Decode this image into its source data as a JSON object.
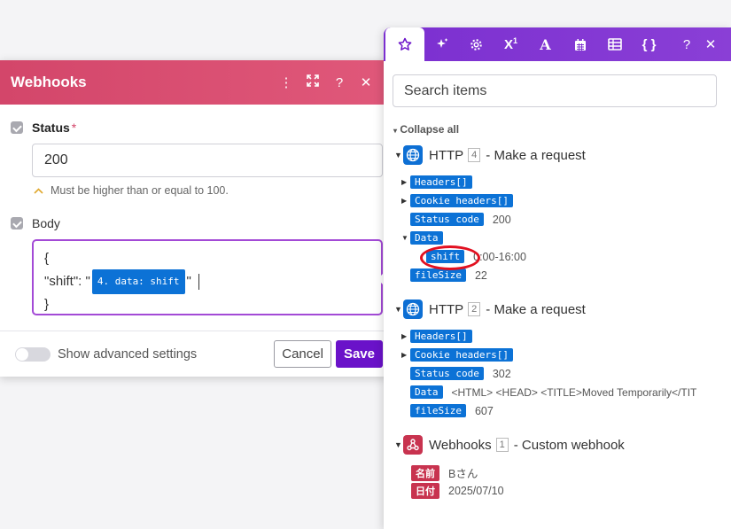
{
  "dialog": {
    "title": "Webhooks",
    "status_label": "Status",
    "required_mark": "*",
    "status_value": "200",
    "status_hint": "Must be higher than or equal to 100.",
    "body_label": "Body",
    "body_line1": "{",
    "body_key": "\"shift\": \"",
    "body_pill": "4. data: shift",
    "body_after": "\"",
    "body_line3": "}",
    "advanced_label": "Show advanced settings",
    "cancel": "Cancel",
    "save": "Save"
  },
  "panel": {
    "tabs": [
      "star-icon",
      "sparkle-icon",
      "gear-icon",
      "superscript-icon",
      "text-icon",
      "calendar-icon",
      "table-icon",
      "braces-icon"
    ],
    "help": "?",
    "close": "✕",
    "search_placeholder": "Search items",
    "collapse_all": "Collapse all",
    "modules": [
      {
        "name": "HTTP",
        "num": "4",
        "desc": "- Make a request",
        "items": [
          {
            "tag": "Headers[]",
            "value": ""
          },
          {
            "tag": "Cookie headers[]",
            "value": ""
          },
          {
            "tag": "Status code",
            "value": "200"
          },
          {
            "tag": "Data",
            "value": ""
          },
          {
            "tag": "shift",
            "value": "0:00-16:00"
          },
          {
            "tag": "fileSize",
            "value": "22"
          }
        ]
      },
      {
        "name": "HTTP",
        "num": "2",
        "desc": "- Make a request",
        "items": [
          {
            "tag": "Headers[]",
            "value": ""
          },
          {
            "tag": "Cookie headers[]",
            "value": ""
          },
          {
            "tag": "Status code",
            "value": "302"
          },
          {
            "tag": "Data",
            "value": "<HTML> <HEAD> <TITLE>Moved Temporarily</TIT"
          },
          {
            "tag": "fileSize",
            "value": "607"
          }
        ]
      },
      {
        "name": "Webhooks",
        "num": "1",
        "desc": "- Custom webhook",
        "items": [
          {
            "tag": "名前",
            "value": "Bさん"
          },
          {
            "tag": "日付",
            "value": "2025/07/10"
          }
        ]
      }
    ]
  },
  "colors": {
    "dialog_header": "#d3466a",
    "panel_header": "#7b2fd0",
    "tag_blue": "#0c72d6",
    "tag_red": "#c8334f",
    "save_button": "#6a12c9"
  }
}
